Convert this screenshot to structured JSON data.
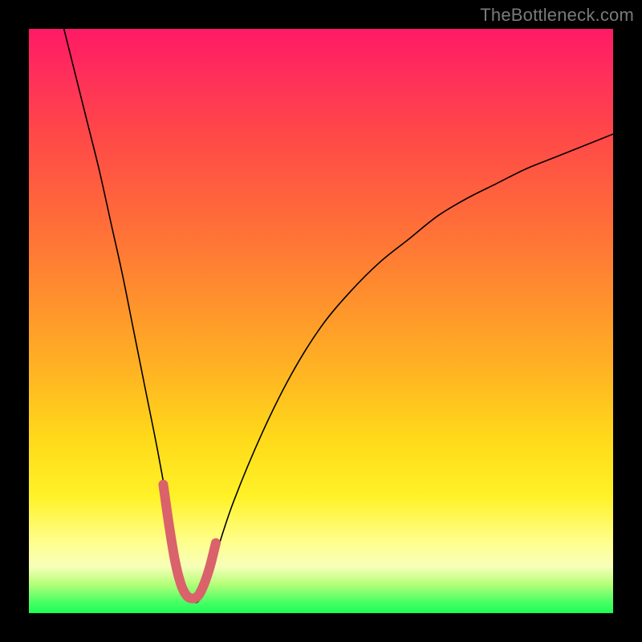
{
  "watermark": "TheBottleneck.com",
  "chart_data": {
    "type": "line",
    "title": "",
    "xlabel": "",
    "ylabel": "",
    "xlim": [
      0,
      100
    ],
    "ylim": [
      0,
      100
    ],
    "grid": false,
    "legend": false,
    "series": [
      {
        "name": "main-curve",
        "color": "#000000",
        "stroke_width": 1.6,
        "x": [
          6,
          8,
          10,
          12,
          14,
          16,
          18,
          20,
          22,
          24,
          25,
          26,
          27,
          28,
          29,
          30,
          32,
          35,
          40,
          45,
          50,
          55,
          60,
          65,
          70,
          75,
          80,
          85,
          90,
          95,
          100
        ],
        "values": [
          100,
          92,
          84,
          76,
          67,
          58,
          48,
          38,
          28,
          17,
          11,
          6,
          3,
          2,
          2,
          4,
          10,
          19,
          31,
          41,
          49,
          55,
          60,
          64,
          68,
          71,
          73.5,
          76,
          78,
          80,
          82
        ]
      },
      {
        "name": "highlight-segment",
        "color": "#d9626b",
        "stroke_width": 12,
        "linecap": "round",
        "x": [
          23,
          24,
          25,
          26,
          27,
          28,
          29,
          30,
          31,
          32
        ],
        "values": [
          22,
          15,
          9,
          5,
          3,
          2.5,
          3,
          5,
          8,
          12
        ]
      }
    ]
  }
}
